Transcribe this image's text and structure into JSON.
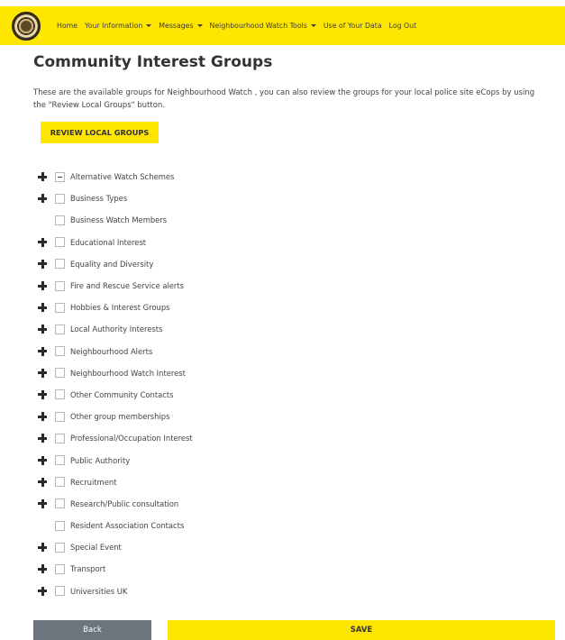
{
  "nav": {
    "logo_icon": "neighbourhood-watch-logo",
    "items": [
      {
        "label": "Home",
        "dropdown": false
      },
      {
        "label": "Your Information",
        "dropdown": true
      },
      {
        "label": "Messages",
        "dropdown": true
      },
      {
        "label": "Neighbourhood Watch Tools",
        "dropdown": true
      },
      {
        "label": "Use of Your Data",
        "dropdown": false
      },
      {
        "label": "Log Out",
        "dropdown": false
      }
    ]
  },
  "page": {
    "title": "Community Interest Groups",
    "intro": "These are the available groups for Neighbourhood Watch , you can also review the groups for your local police site eCops by using the \"Review Local Groups\" button.",
    "review_button": "REVIEW LOCAL GROUPS"
  },
  "groups": [
    {
      "label": "Alternative Watch Schemes",
      "expandable": true,
      "state": "partial"
    },
    {
      "label": "Business Types",
      "expandable": true,
      "state": "unchecked"
    },
    {
      "label": "Business Watch Members",
      "expandable": false,
      "state": "unchecked"
    },
    {
      "label": "Educational Interest",
      "expandable": true,
      "state": "unchecked"
    },
    {
      "label": "Equality and Diversity",
      "expandable": true,
      "state": "unchecked"
    },
    {
      "label": "Fire and Rescue Service alerts",
      "expandable": true,
      "state": "unchecked"
    },
    {
      "label": "Hobbies & Interest Groups",
      "expandable": true,
      "state": "unchecked"
    },
    {
      "label": "Local Authority Interests",
      "expandable": true,
      "state": "unchecked"
    },
    {
      "label": "Neighbourhood Alerts",
      "expandable": true,
      "state": "unchecked"
    },
    {
      "label": "Neighbourhood Watch Interest",
      "expandable": true,
      "state": "unchecked"
    },
    {
      "label": "Other Community Contacts",
      "expandable": true,
      "state": "unchecked"
    },
    {
      "label": "Other group memberships",
      "expandable": true,
      "state": "unchecked"
    },
    {
      "label": "Professional/Occupation Interest",
      "expandable": true,
      "state": "unchecked"
    },
    {
      "label": "Public Authority",
      "expandable": true,
      "state": "unchecked"
    },
    {
      "label": "Recruitment",
      "expandable": true,
      "state": "unchecked"
    },
    {
      "label": "Research/Public consultation",
      "expandable": true,
      "state": "unchecked"
    },
    {
      "label": "Resident Association Contacts",
      "expandable": false,
      "state": "unchecked"
    },
    {
      "label": "Special Event",
      "expandable": true,
      "state": "unchecked"
    },
    {
      "label": "Transport",
      "expandable": true,
      "state": "unchecked"
    },
    {
      "label": "Universities UK",
      "expandable": true,
      "state": "unchecked"
    }
  ],
  "footer": {
    "back_label": "Back",
    "save_label": "SAVE"
  },
  "colors": {
    "brand_yellow": "#ffe600",
    "back_grey": "#6c757d"
  }
}
